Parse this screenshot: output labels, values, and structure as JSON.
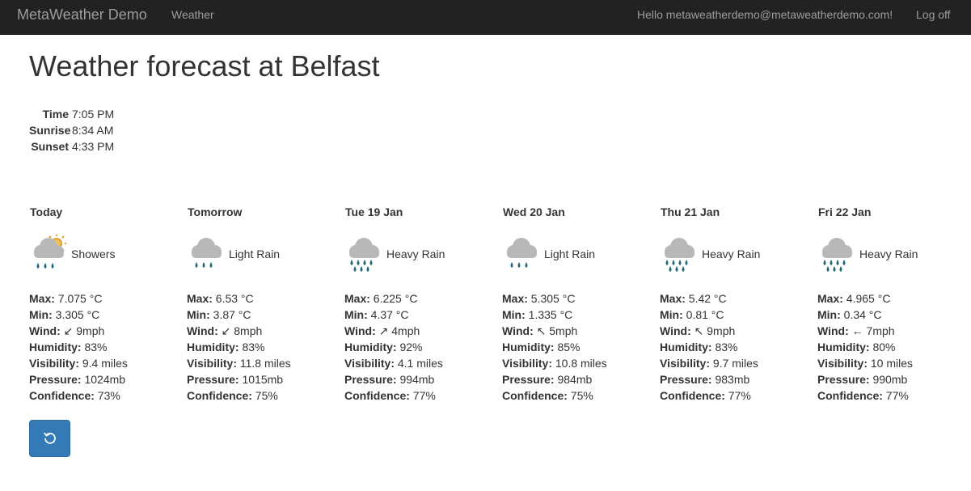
{
  "nav": {
    "brand": "MetaWeather Demo",
    "weather_link": "Weather",
    "hello": "Hello metaweatherdemo@metaweatherdemo.com!",
    "logoff": "Log off"
  },
  "page": {
    "title": "Weather forecast at Belfast"
  },
  "sun": {
    "time_label": "Time",
    "time": "7:05 PM",
    "sunrise_label": "Sunrise",
    "sunrise": "8:34 AM",
    "sunset_label": "Sunset",
    "sunset": "4:33 PM"
  },
  "labels": {
    "max": "Max:",
    "min": "Min:",
    "wind": "Wind:",
    "humidity": "Humidity:",
    "visibility": "Visibility:",
    "pressure": "Pressure:",
    "confidence": "Confidence:"
  },
  "days": [
    {
      "name": "Today",
      "icon": "showers-icon",
      "condition": "Showers",
      "max": "7.075 °C",
      "min": "3.305 °C",
      "wind": "↙ 9mph",
      "humidity": "83%",
      "visibility": "9.4 miles",
      "pressure": "1024mb",
      "confidence": "73%"
    },
    {
      "name": "Tomorrow",
      "icon": "light-rain-icon",
      "condition": "Light Rain",
      "max": "6.53 °C",
      "min": "3.87 °C",
      "wind": "↙ 8mph",
      "humidity": "83%",
      "visibility": "11.8 miles",
      "pressure": "1015mb",
      "confidence": "75%"
    },
    {
      "name": "Tue 19 Jan",
      "icon": "heavy-rain-icon",
      "condition": "Heavy Rain",
      "max": "6.225 °C",
      "min": "4.37 °C",
      "wind": "↗ 4mph",
      "humidity": "92%",
      "visibility": "4.1 miles",
      "pressure": "994mb",
      "confidence": "77%"
    },
    {
      "name": "Wed 20 Jan",
      "icon": "light-rain-icon",
      "condition": "Light Rain",
      "max": "5.305 °C",
      "min": "1.335 °C",
      "wind": "↖ 5mph",
      "humidity": "85%",
      "visibility": "10.8 miles",
      "pressure": "984mb",
      "confidence": "75%"
    },
    {
      "name": "Thu 21 Jan",
      "icon": "heavy-rain-icon",
      "condition": "Heavy Rain",
      "max": "5.42 °C",
      "min": "0.81 °C",
      "wind": "↖ 9mph",
      "humidity": "83%",
      "visibility": "9.7 miles",
      "pressure": "983mb",
      "confidence": "77%"
    },
    {
      "name": "Fri 22 Jan",
      "icon": "heavy-rain-icon",
      "condition": "Heavy Rain",
      "max": "4.965 °C",
      "min": "0.34 °C",
      "wind": "← 7mph",
      "humidity": "80%",
      "visibility": "10 miles",
      "pressure": "990mb",
      "confidence": "77%"
    }
  ],
  "refresh_button": {
    "icon": "refresh-icon"
  },
  "colors": {
    "navbar": "#222222",
    "nav_text": "#9d9d9d",
    "button": "#337ab7",
    "cloud": "#b8b8b8",
    "rain": "#1f6b7d",
    "sun": "#e0a030"
  }
}
